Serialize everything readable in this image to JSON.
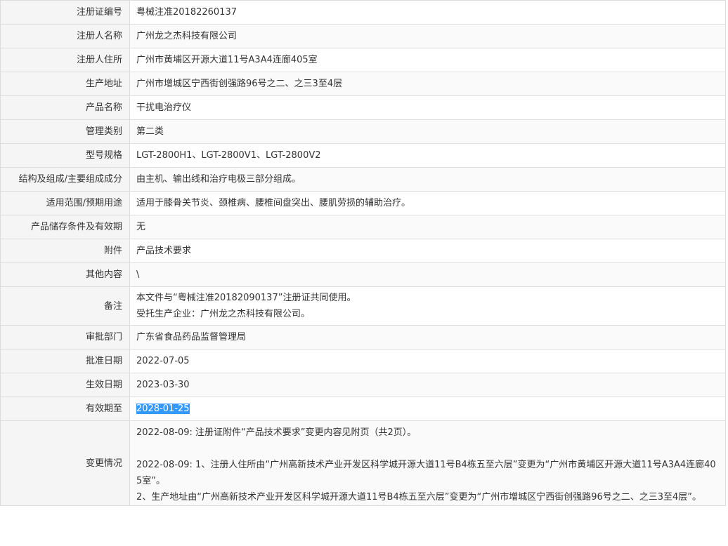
{
  "rows": [
    {
      "label": "注册证编号",
      "value": "粤械注准20182260137"
    },
    {
      "label": "注册人名称",
      "value": "广州龙之杰科技有限公司"
    },
    {
      "label": "注册人住所",
      "value": "广州市黄埔区开源大道11号A3A4连廊405室"
    },
    {
      "label": "生产地址",
      "value": "广州市增城区宁西街创强路96号之二、之三3至4层"
    },
    {
      "label": "产品名称",
      "value": "干扰电治疗仪"
    },
    {
      "label": "管理类别",
      "value": "第二类"
    },
    {
      "label": "型号规格",
      "value": "LGT-2800H1、LGT-2800V1、LGT-2800V2"
    },
    {
      "label": "结构及组成/主要组成成分",
      "value": "由主机、输出线和治疗电极三部分组成。"
    },
    {
      "label": "适用范围/预期用途",
      "value": "适用于膝骨关节炎、颈椎病、腰椎间盘突出、腰肌劳损的辅助治疗。"
    },
    {
      "label": "产品储存条件及有效期",
      "value": "无"
    },
    {
      "label": "附件",
      "value": "产品技术要求"
    },
    {
      "label": "其他内容",
      "value": "\\"
    },
    {
      "label": "备注",
      "lines": [
        "本文件与“粤械注准20182090137”注册证共同使用。",
        "受托生产企业：广州龙之杰科技有限公司。"
      ]
    },
    {
      "label": "审批部门",
      "value": "广东省食品药品监督管理局"
    },
    {
      "label": "批准日期",
      "value": "2022-07-05"
    },
    {
      "label": "生效日期",
      "value": "2023-03-30"
    },
    {
      "label": "有效期至",
      "value": "2028-01-25"
    },
    {
      "label": "变更情况",
      "lines": [
        "2022-08-09: 注册证附件“产品技术要求”变更内容见附页（共2页）。",
        "2022-08-09: 1、注册人住所由“广州高新技术产业开发区科学城开源大道11号B4栋五至六层”变更为“广州市黄埔区开源大道11号A3A4连廊405室”。",
        "2、生产地址由“广州高新技术产业开发区科学城开源大道11号B4栋五至六层”变更为“广州市增城区宁西街创强路96号之二、之三3至4层”。"
      ]
    }
  ]
}
